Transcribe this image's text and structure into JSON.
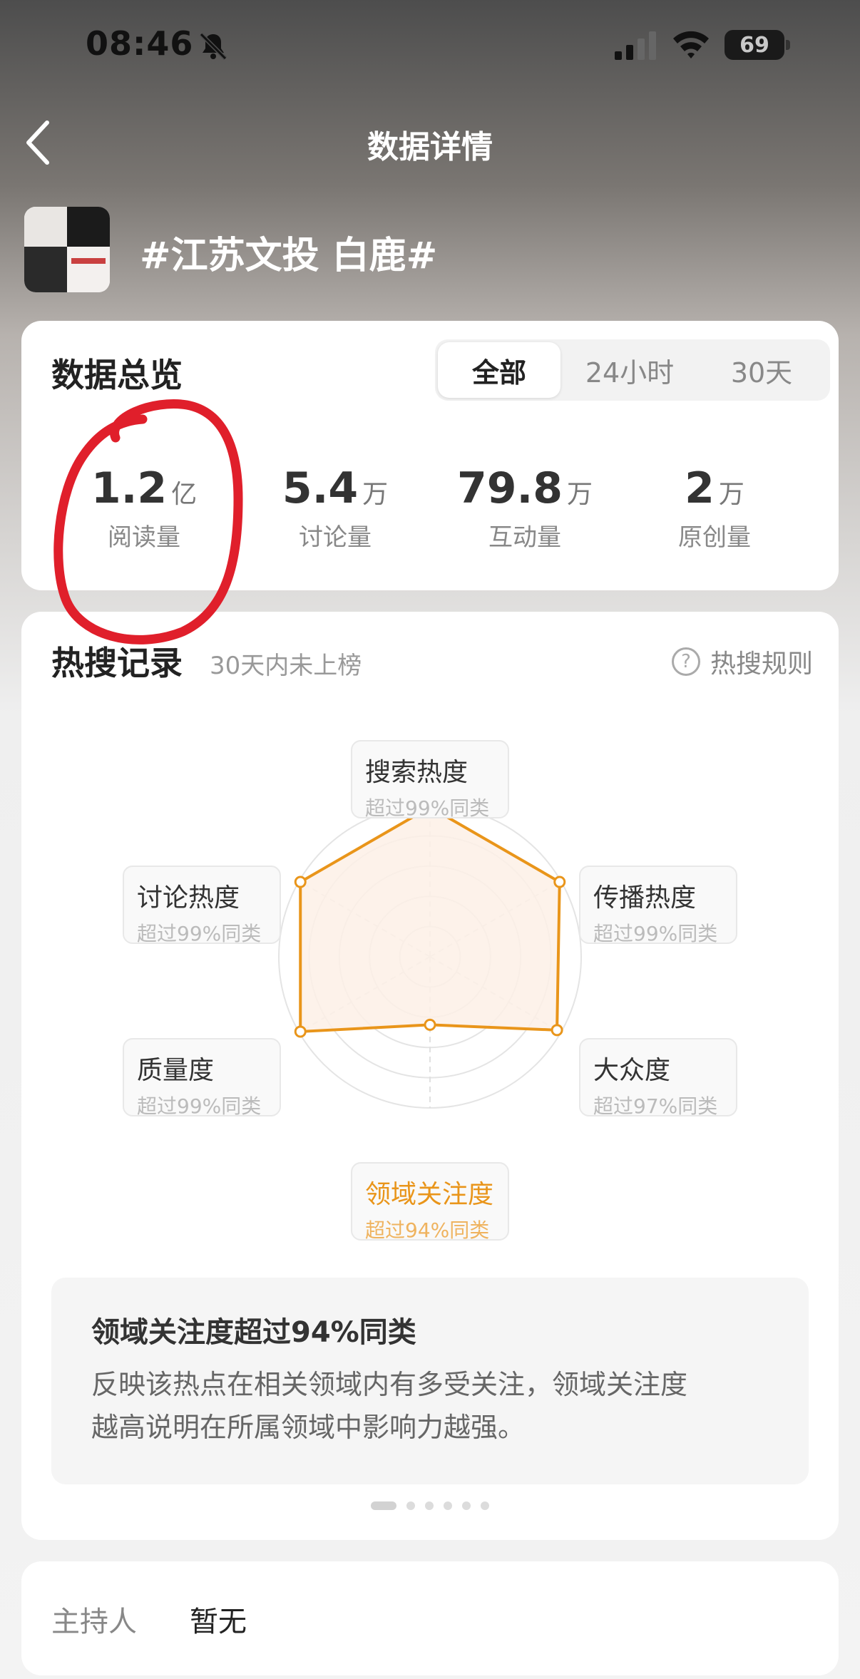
{
  "status_bar": {
    "time": "08:46",
    "battery": "69"
  },
  "nav": {
    "title": "数据详情"
  },
  "topic": {
    "title": "#江苏文投 白鹿#"
  },
  "overview": {
    "title": "数据总览",
    "tabs": [
      "全部",
      "24小时",
      "30天"
    ],
    "active_tab": "全部",
    "metrics": [
      {
        "value": "1.2",
        "unit": "亿",
        "label": "阅读量"
      },
      {
        "value": "5.4",
        "unit": "万",
        "label": "讨论量"
      },
      {
        "value": "79.8",
        "unit": "万",
        "label": "互动量"
      },
      {
        "value": "2",
        "unit": "万",
        "label": "原创量"
      }
    ]
  },
  "hot_search": {
    "title": "热搜记录",
    "note": "30天内未上榜",
    "rules_label": "热搜规则",
    "dimensions": [
      {
        "name": "搜索热度",
        "pct": "超过99%同类",
        "value": 0.99
      },
      {
        "name": "传播热度",
        "pct": "超过99%同类",
        "value": 0.99
      },
      {
        "name": "大众度",
        "pct": "超过97%同类",
        "value": 0.97
      },
      {
        "name": "领域关注度",
        "pct": "超过94%同类",
        "value": 0.45
      },
      {
        "name": "质量度",
        "pct": "超过99%同类",
        "value": 0.99
      },
      {
        "name": "讨论热度",
        "pct": "超过99%同类",
        "value": 0.99
      }
    ],
    "highlight_index": 3,
    "info_title": "领域关注度超过94%同类",
    "info_body_line1": "反映该热点在相关领域内有多受关注，领域关注度",
    "info_body_line2": "越高说明在所属领域中影响力越强。",
    "page_count": 6,
    "active_page": 0
  },
  "host": {
    "label": "主持人",
    "value": "暂无"
  },
  "colors": {
    "accent": "#e9951a",
    "radar_fill": "#fdf0e6",
    "annotation": "#e01f2b"
  }
}
